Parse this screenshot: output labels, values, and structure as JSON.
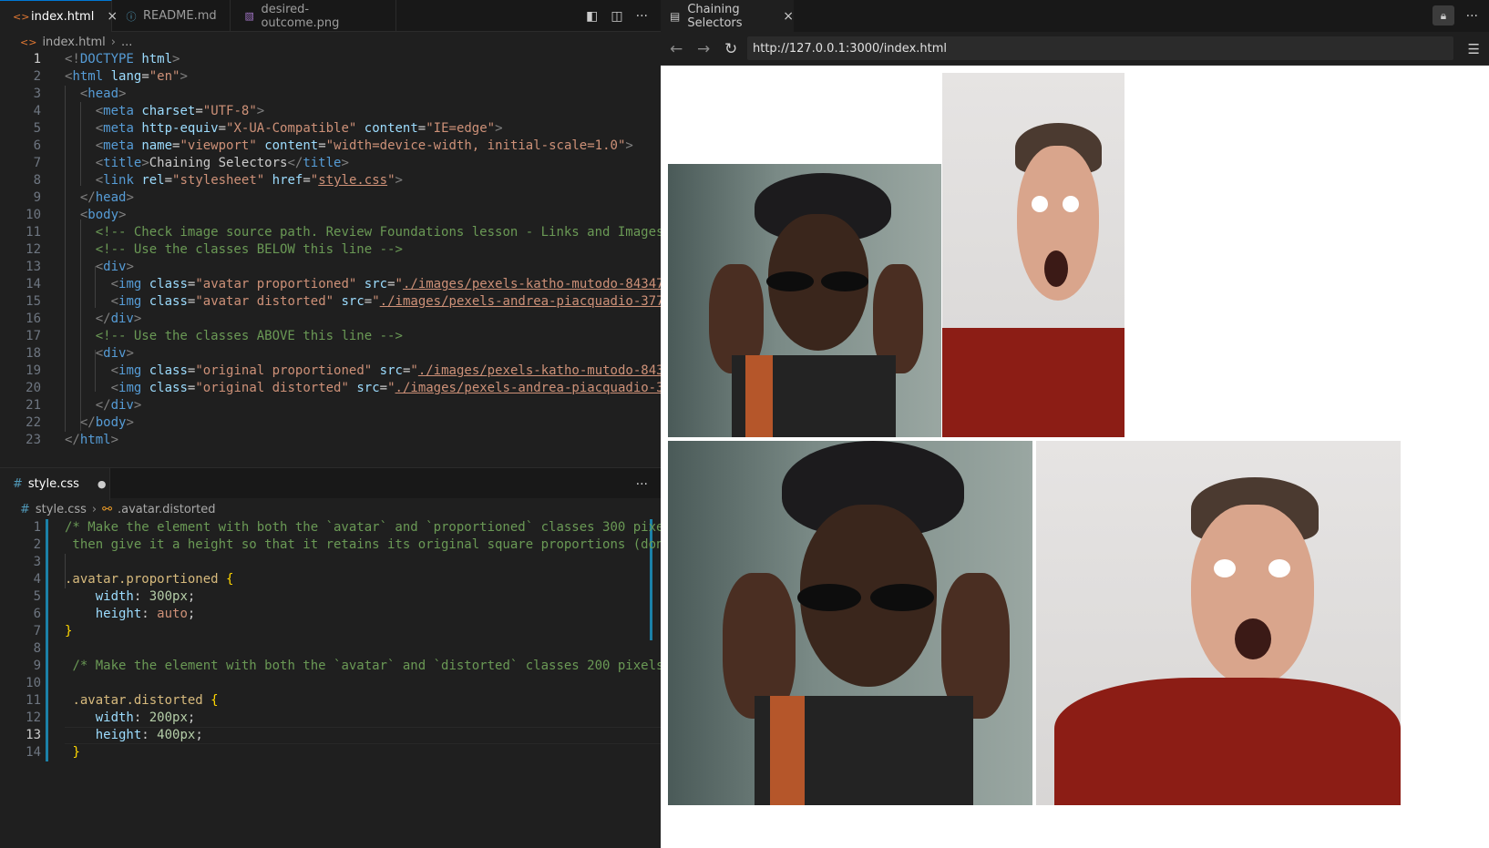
{
  "editor": {
    "tabs": [
      {
        "label": "index.html",
        "icon": "html-file-icon",
        "active": true
      },
      {
        "label": "README.md",
        "icon": "info-icon",
        "active": false
      },
      {
        "label": "desired-outcome.png",
        "icon": "image-file-icon",
        "active": false
      }
    ],
    "html_breadcrumb": {
      "file": "index.html",
      "rest": "..."
    },
    "css_tab": {
      "label": "style.css",
      "modified_dot": "●"
    },
    "css_breadcrumb": {
      "file": "style.css",
      "symbol": ".avatar.distorted"
    }
  },
  "browser": {
    "tab_title": "Chaining Selectors",
    "url": "http://127.0.0.1:3000/index.html"
  },
  "icons": {
    "split": "split-editor-icon",
    "layout": "layout-icon",
    "more": "more-actions-icon",
    "back": "back-arrow-icon",
    "forward": "forward-arrow-icon",
    "reload": "reload-icon",
    "menu": "hamburger-menu-icon",
    "lock": "lock-icon"
  }
}
